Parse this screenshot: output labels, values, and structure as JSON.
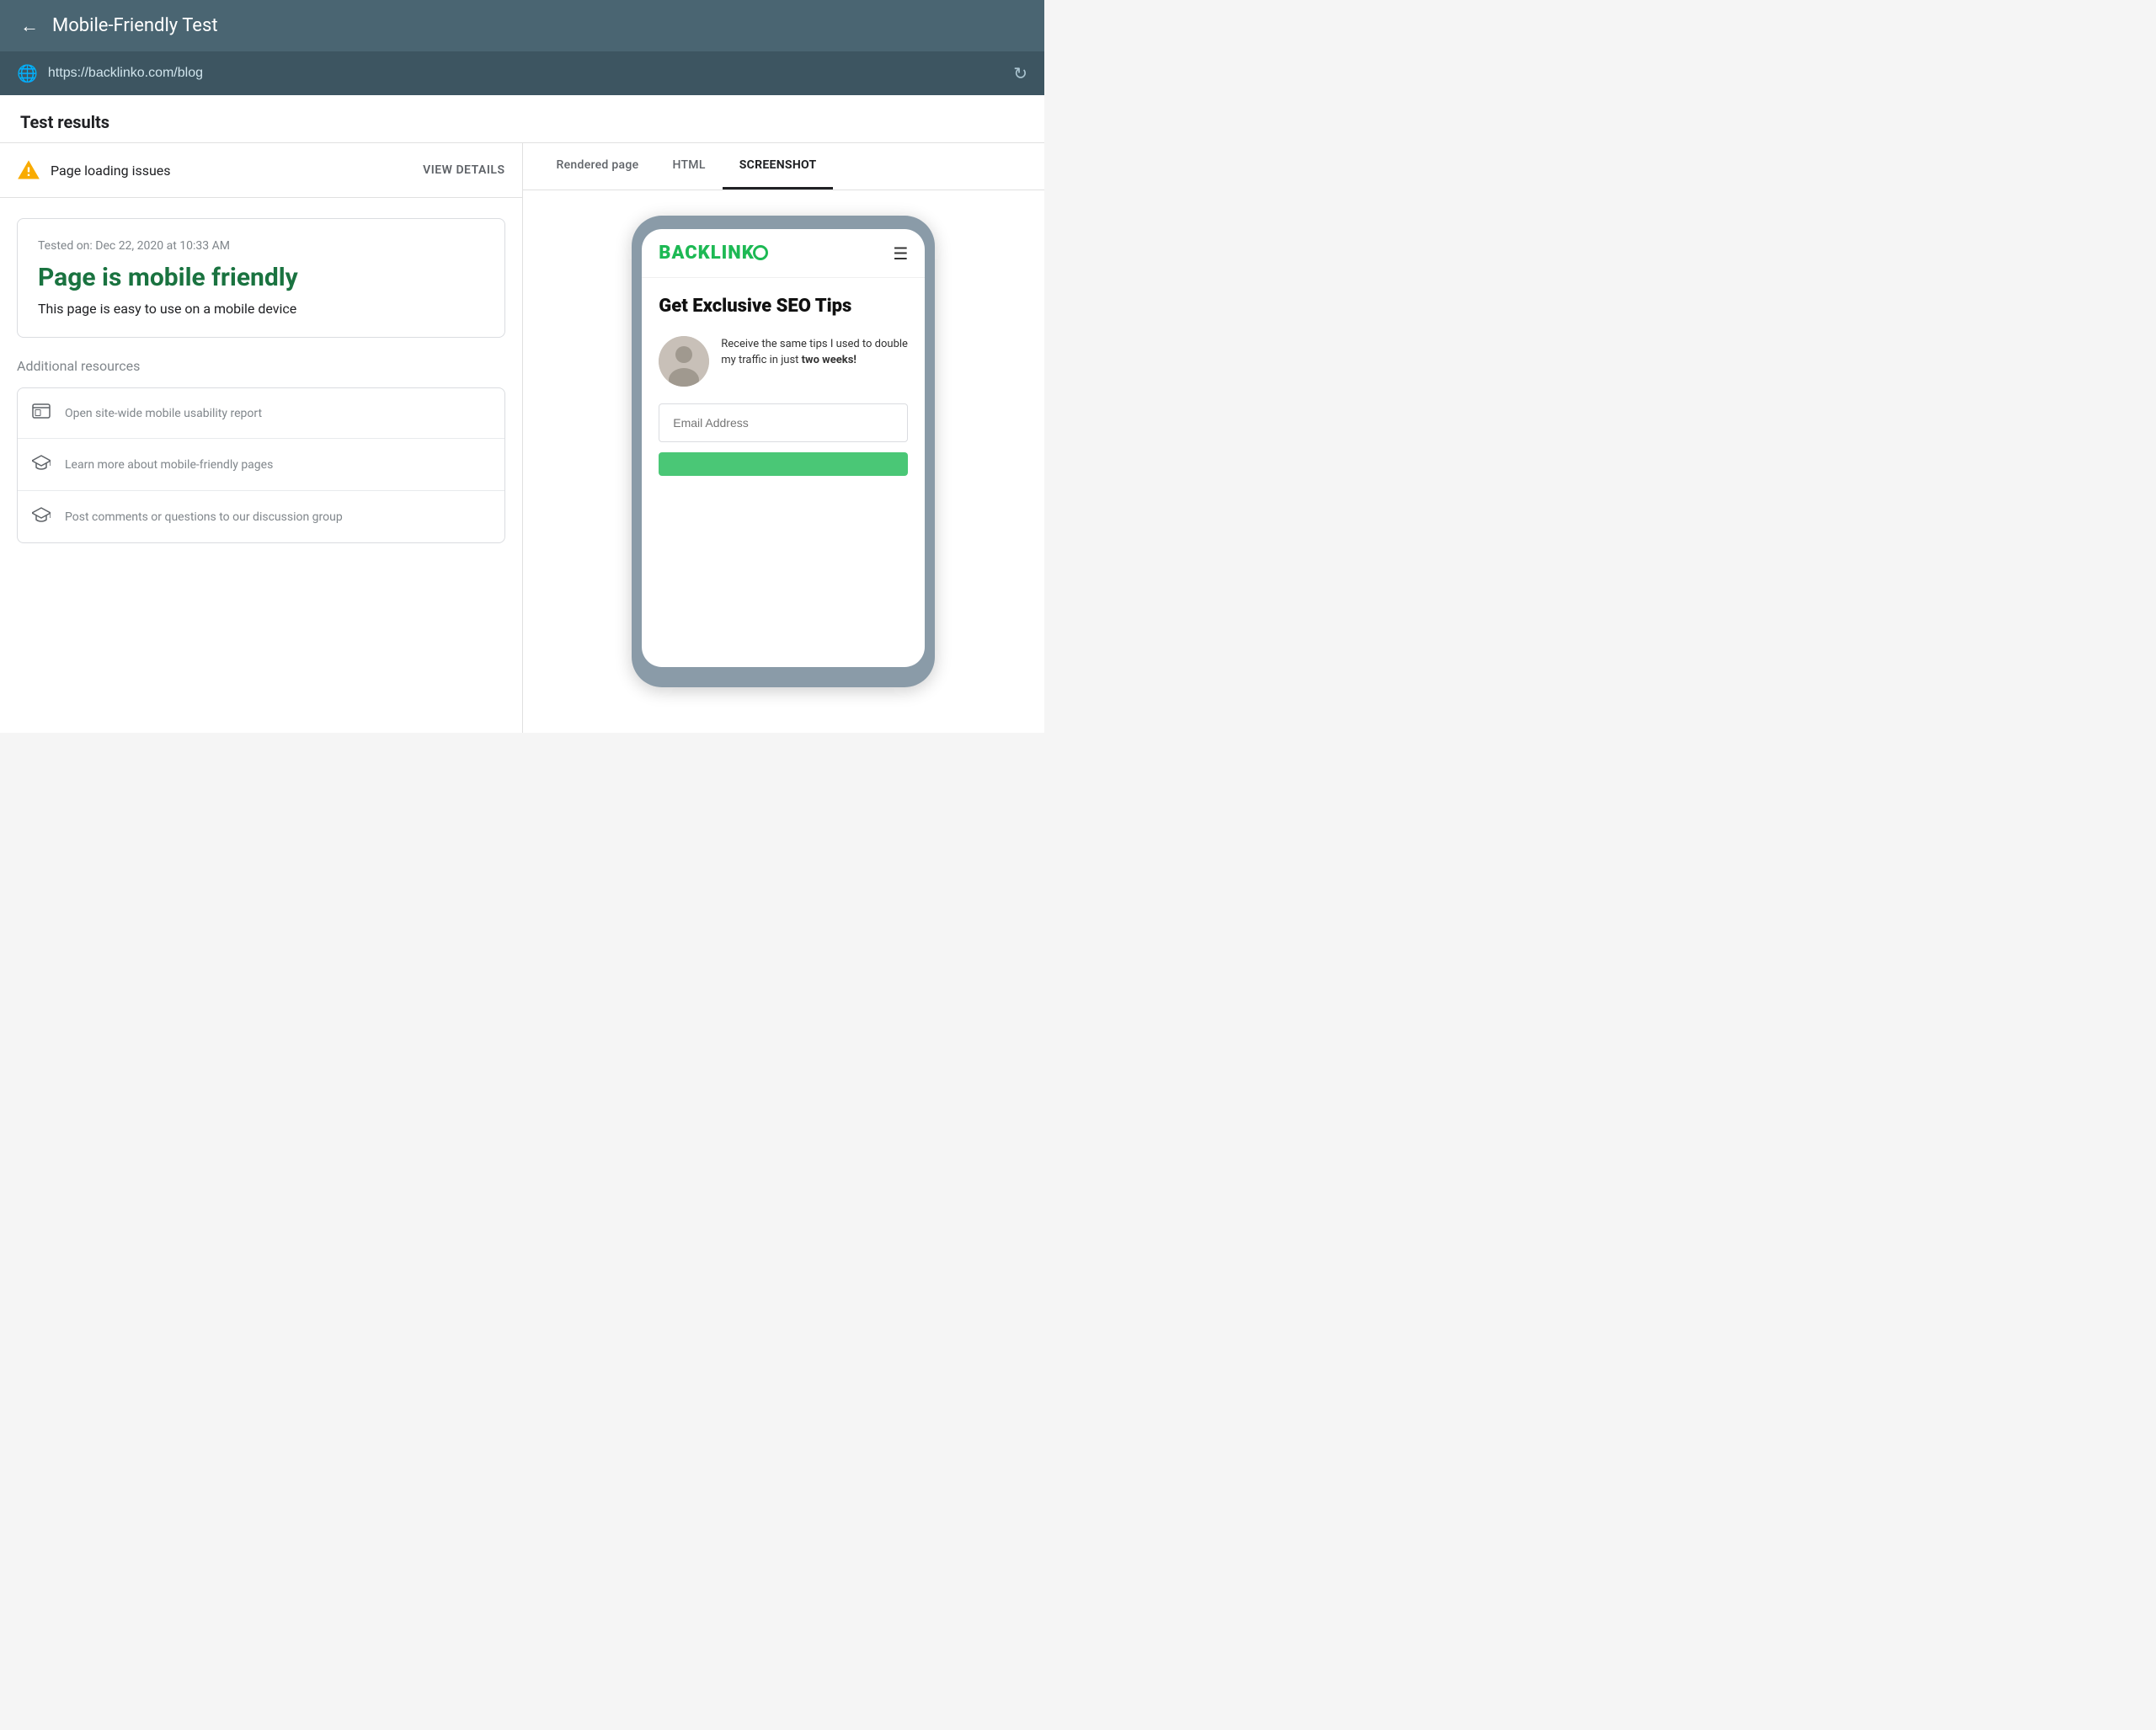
{
  "header": {
    "back_icon": "←",
    "title": "Mobile-Friendly Test"
  },
  "url_bar": {
    "globe_icon": "🌐",
    "url": "https://backlinko.com/blog",
    "refresh_icon": "↻"
  },
  "test_results": {
    "section_title": "Test results"
  },
  "issues_bar": {
    "warning_text": "Page loading issues",
    "view_details_label": "VIEW DETAILS"
  },
  "result_card": {
    "tested_on": "Tested on: Dec 22, 2020 at 10:33 AM",
    "result_title": "Page is mobile friendly",
    "result_description": "This page is easy to use on a mobile device"
  },
  "additional_resources": {
    "title": "Additional resources",
    "items": [
      {
        "icon": "browser",
        "text": "Open site-wide mobile usability report"
      },
      {
        "icon": "graduation",
        "text": "Learn more about mobile-friendly pages"
      },
      {
        "icon": "graduation",
        "text": "Post comments or questions to our discussion group"
      }
    ]
  },
  "right_panel": {
    "tabs": [
      {
        "label": "Rendered page",
        "active": false
      },
      {
        "label": "HTML",
        "active": false
      },
      {
        "label": "SCREENSHOT",
        "active": true
      }
    ]
  },
  "mobile_preview": {
    "logo_text": "BACKLINKO",
    "headline": "Get Exclusive SEO Tips",
    "opt_in_text_1": "Receive the same tips I used to double my traffic in just ",
    "opt_in_bold": "two weeks!",
    "email_placeholder": "Email Address"
  }
}
